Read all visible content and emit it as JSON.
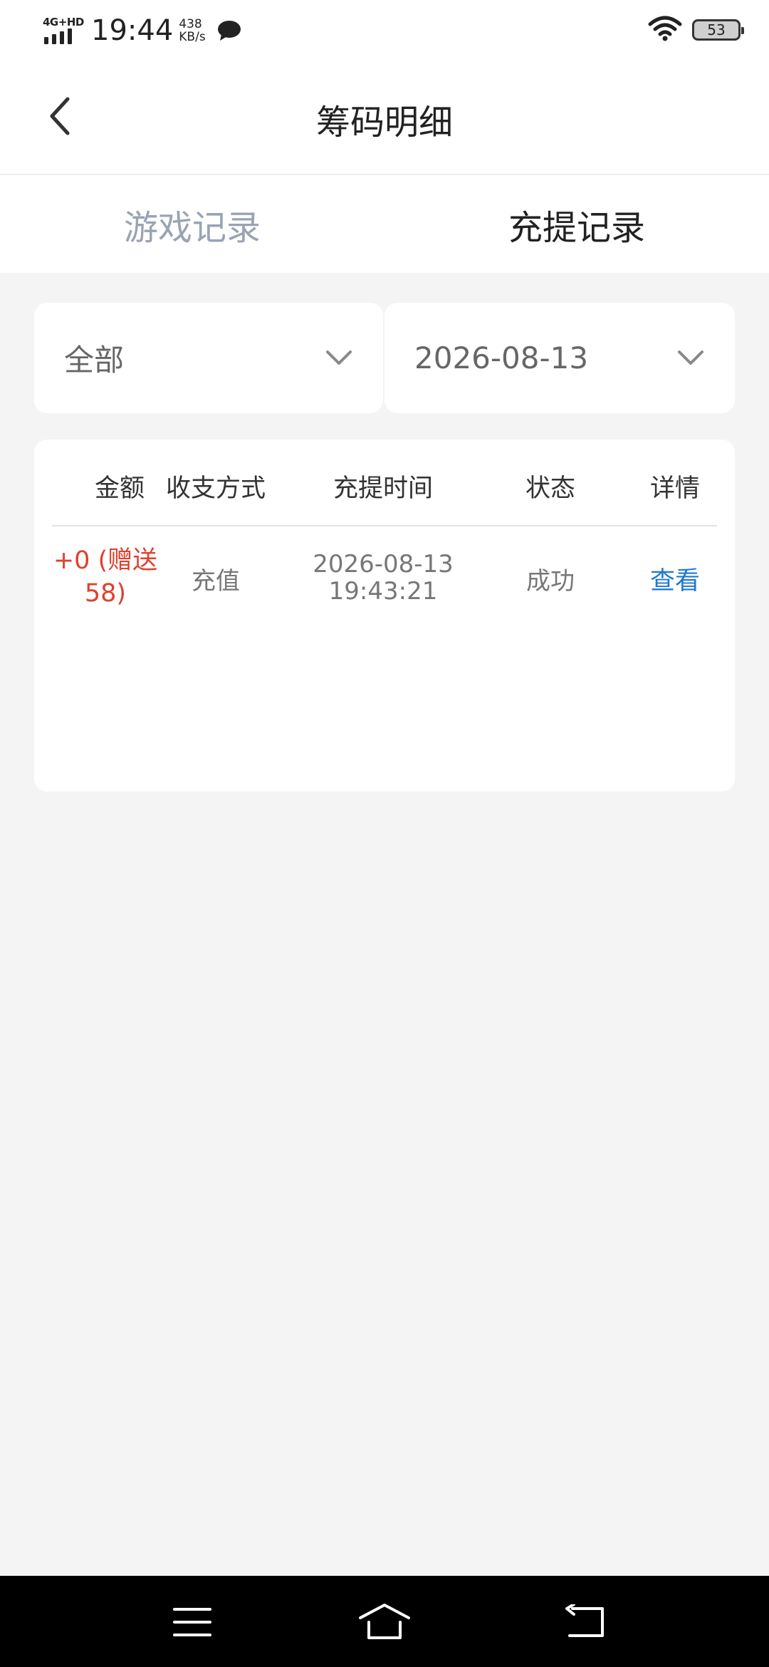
{
  "status_bar": {
    "network": "4G+HD",
    "time": "19:44",
    "speed_value": "438",
    "speed_unit": "KB/s",
    "battery": "53"
  },
  "header": {
    "title": "筹码明细"
  },
  "tabs": [
    {
      "label": "游戏记录",
      "active": false
    },
    {
      "label": "充提记录",
      "active": true
    }
  ],
  "filters": {
    "type_value": "全部",
    "date_value": "2026-08-13"
  },
  "table": {
    "columns": [
      "金额",
      "收支方式",
      "充提时间",
      "状态",
      "详情"
    ],
    "rows": [
      {
        "amount_line1": "+0 (赠送",
        "amount_line2": "58)",
        "method": "充值",
        "date": "2026-08-13",
        "time": "19:43:21",
        "status": "成功",
        "detail": "查看"
      }
    ]
  },
  "colors": {
    "accent_blue": "#1e78d2",
    "amount_red": "#e0402e",
    "inactive_tab": "#9aa3b4",
    "background": "#f4f4f4"
  }
}
